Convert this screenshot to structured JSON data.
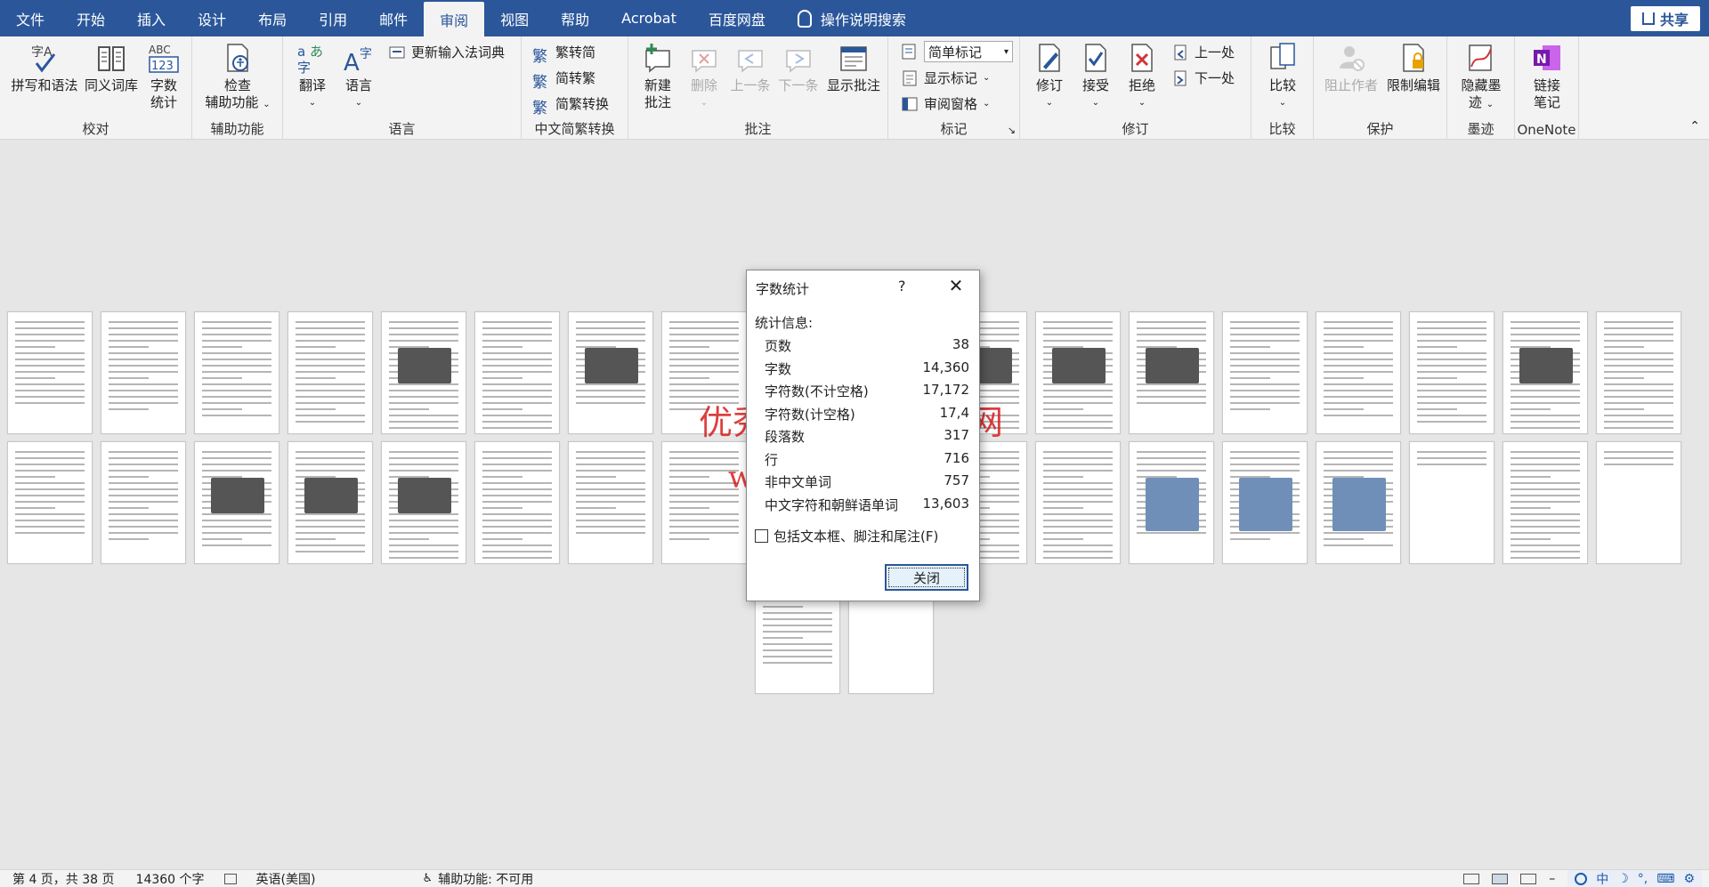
{
  "tabs": [
    "文件",
    "开始",
    "插入",
    "设计",
    "布局",
    "引用",
    "邮件",
    "审阅",
    "视图",
    "帮助",
    "Acrobat",
    "百度网盘"
  ],
  "active_tab": "审阅",
  "search_label": "操作说明搜索",
  "share_label": "共享",
  "ribbon": {
    "proofing": {
      "label": "校对",
      "spelling": "拼写和语法",
      "thesaurus": "同义词库",
      "wordcount_1": "字数",
      "wordcount_2": "统计"
    },
    "accessibility": {
      "label": "辅助功能",
      "check_1": "检查",
      "check_2": "辅助功能"
    },
    "language": {
      "label": "语言",
      "translate": "翻译",
      "language": "语言",
      "update_ime": "更新输入法词典"
    },
    "chinese": {
      "label": "中文简繁转换",
      "to_simplified": "繁转简",
      "to_traditional": "简转繁",
      "convert": "简繁转换"
    },
    "comments": {
      "label": "批注",
      "new_1": "新建",
      "new_2": "批注",
      "delete": "删除",
      "prev": "上一条",
      "next": "下一条",
      "show": "显示批注"
    },
    "tracking": {
      "label": "标记",
      "markup_select": "简单标记",
      "show_markup": "显示标记",
      "review_pane": "审阅窗格"
    },
    "changes": {
      "label": "修订",
      "track": "修订",
      "accept": "接受",
      "reject": "拒绝",
      "prev": "上一处",
      "next": "下一处"
    },
    "compare": {
      "label": "比较",
      "compare": "比较"
    },
    "protect": {
      "label": "保护",
      "block": "阻止作者",
      "restrict": "限制编辑"
    },
    "ink": {
      "label": "墨迹",
      "hide_1": "隐藏墨",
      "hide_2": "迹"
    },
    "onenote": {
      "label": "OneNote",
      "link_1": "链接",
      "link_2": "笔记"
    }
  },
  "watermark": {
    "line1": "优秀毕业设计资源网",
    "line2": "www.keyicad.cn"
  },
  "dialog": {
    "title": "字数统计",
    "help": "?",
    "section": "统计信息:",
    "stats": [
      {
        "label": "页数",
        "value": "38"
      },
      {
        "label": "字数",
        "value": "14,360"
      },
      {
        "label": "字符数(不计空格)",
        "value": "17,172"
      },
      {
        "label": "字符数(计空格)",
        "value": "17,4"
      },
      {
        "label": "段落数",
        "value": "317"
      },
      {
        "label": "行",
        "value": "716"
      },
      {
        "label": "非中文单词",
        "value": "757"
      },
      {
        "label": "中文字符和朝鲜语单词",
        "value": "13,603"
      }
    ],
    "include_label": "包括文本框、脚注和尾注(F)",
    "close_label": "关闭"
  },
  "status": {
    "page": "第 4 页，共 38 页",
    "words": "14360 个字",
    "language": "英语(美国)",
    "accessibility": "辅助功能: 不可用"
  },
  "ime": {
    "mode": "中"
  },
  "colors": {
    "title_bar": "#2b579a",
    "ribbon_bg": "#f3f3f3",
    "canvas_bg": "#e6e6e6",
    "watermark": "#d81e1e"
  }
}
